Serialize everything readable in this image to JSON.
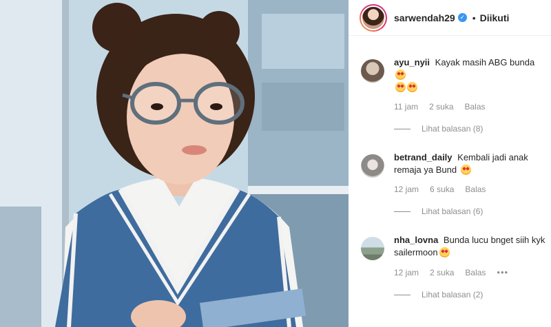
{
  "post": {
    "author": "sarwendah29",
    "follow_label": "Diikuti",
    "separator": "•"
  },
  "comments": [
    {
      "user": "ayu_nyii",
      "text": "Kayak masih ABG bunda",
      "time": "11 jam",
      "likes": "2 suka",
      "reply_label": "Balas",
      "view_replies": "Lihat balasan (8)"
    },
    {
      "user": "betrand_daily",
      "text": "Kembali jadi anak remaja ya Bund",
      "time": "12 jam",
      "likes": "6 suka",
      "reply_label": "Balas",
      "view_replies": "Lihat balasan (6)"
    },
    {
      "user": "nha_lovna",
      "text": "Bunda lucu bnget siih kyk sailermoon",
      "time": "12 jam",
      "likes": "2 suka",
      "reply_label": "Balas",
      "more": "•••",
      "view_replies": "Lihat balasan (2)"
    }
  ],
  "colors": {
    "verified": "#3897f0",
    "muted": "#8e8e8e",
    "text": "#262626"
  },
  "icons": [
    "verified-badge-icon",
    "star-struck-emoji-icon",
    "more-options-icon"
  ]
}
